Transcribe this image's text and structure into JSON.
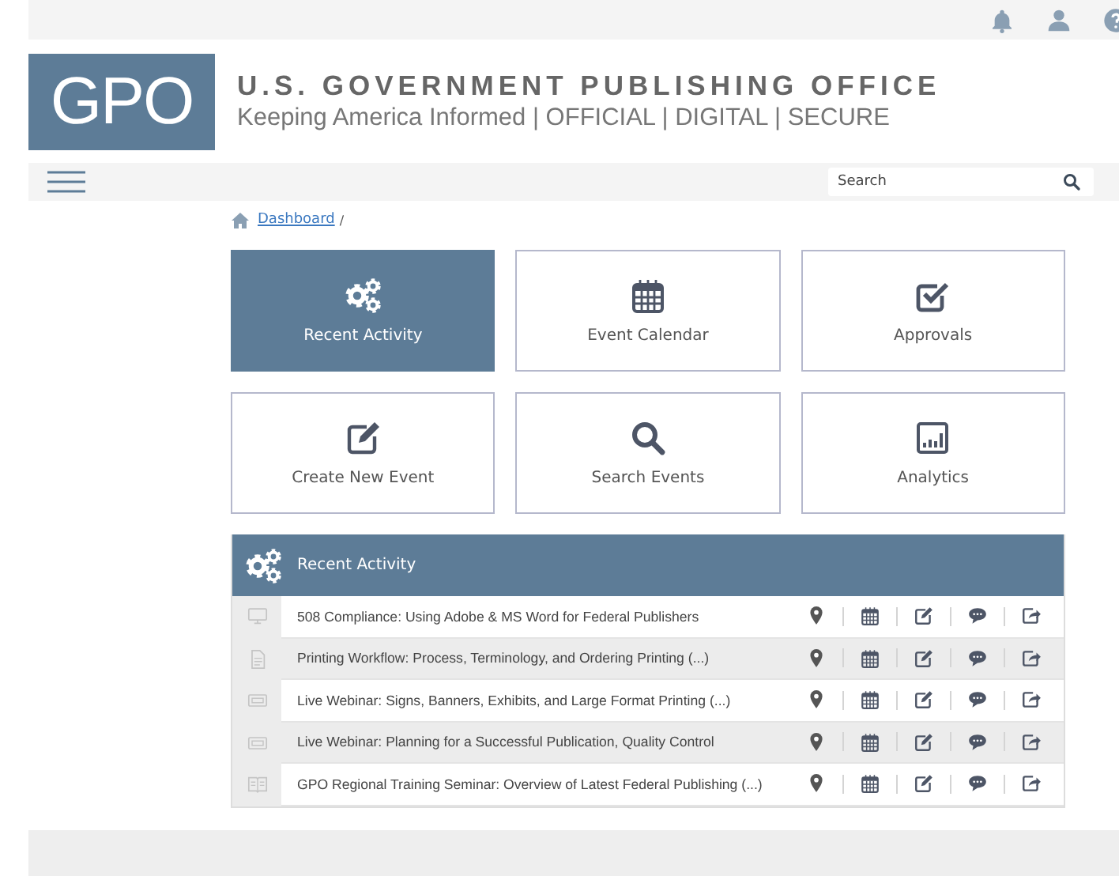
{
  "header": {
    "logo": "GPO",
    "title": "U.S. GOVERNMENT PUBLISHING OFFICE",
    "tagline": "Keeping America Informed | OFFICIAL | DIGITAL | SECURE"
  },
  "search": {
    "placeholder": "Search"
  },
  "breadcrumb": {
    "link": "Dashboard",
    "separator": "/"
  },
  "tiles": [
    {
      "label": "Recent Activity",
      "kind": "gears",
      "selected": true
    },
    {
      "label": "Event Calendar",
      "kind": "calendar",
      "selected": false
    },
    {
      "label": "Approvals",
      "kind": "check",
      "selected": false
    },
    {
      "label": "Create New Event",
      "kind": "edit",
      "selected": false
    },
    {
      "label": "Search Events",
      "kind": "search",
      "selected": false
    },
    {
      "label": "Analytics",
      "kind": "chart",
      "selected": false
    }
  ],
  "recent_activity": {
    "title": "Recent Activity",
    "rows": [
      {
        "kind": "monitor",
        "title": "508 Compliance: Using Adobe & MS Word for Federal Publishers"
      },
      {
        "kind": "document",
        "title": "Printing Workflow: Process, Terminology, and Ordering Printing (...)"
      },
      {
        "kind": "ticket",
        "title": "Live Webinar: Signs, Banners, Exhibits, and Large Format Printing (...)"
      },
      {
        "kind": "ticket",
        "title": "Live Webinar: Planning for a Successful Publication, Quality Control"
      },
      {
        "kind": "book",
        "title": "GPO Regional Training Seminar: Overview of Latest Federal Publishing (...)"
      }
    ]
  }
}
